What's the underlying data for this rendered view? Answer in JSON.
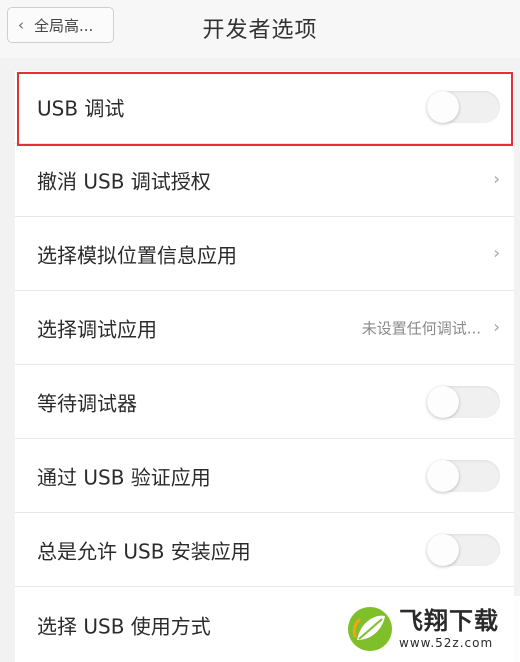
{
  "header": {
    "back_label": "全局高...",
    "title": "开发者选项"
  },
  "rows": [
    {
      "label": "USB 调试",
      "control": "toggle",
      "on": false
    },
    {
      "label": "撤消 USB 调试授权",
      "control": "chevron"
    },
    {
      "label": "选择模拟位置信息应用",
      "control": "chevron"
    },
    {
      "label": "选择调试应用",
      "value": "未设置任何调试...",
      "control": "chevron"
    },
    {
      "label": "等待调试器",
      "control": "toggle",
      "on": false
    },
    {
      "label": "通过 USB 验证应用",
      "control": "toggle",
      "on": false
    },
    {
      "label": "总是允许 USB 安装应用",
      "control": "toggle",
      "on": false
    },
    {
      "label": "选择 USB 使用方式",
      "control": "none"
    }
  ],
  "highlight_color": "#e0303a",
  "watermark": {
    "brand": "飞翔下载",
    "url": "www.52z.com"
  }
}
